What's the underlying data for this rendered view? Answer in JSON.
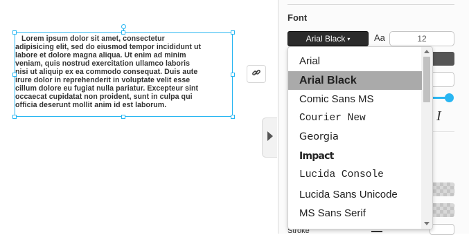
{
  "canvas": {
    "text_lines": [
      "   Lorem ipsum dolor sit amet, consectetur",
      "adipisicing elit, sed do eiusmod tempor incididunt ut",
      "labore et dolore magna aliqua. Ut enim ad minim",
      "veniam, quis nostrud exercitation ullamco laboris",
      "nisi ut aliquip ex ea commodo consequat. Duis aute",
      "irure dolor in reprehenderit in voluptate velit esse",
      "cillum dolore eu fugiat nulla pariatur. Excepteur sint",
      "occaecat cupidatat non proident, sunt in culpa qui",
      "officia deserunt mollit anim id est laborum."
    ],
    "link_icon": "link-icon",
    "selection_color": "#29b6f2"
  },
  "panel": {
    "section_title": "Font",
    "font_button_label": "Arial Black",
    "aa_label": "Aa",
    "font_size_value": "12",
    "stroke_label": "Stroke",
    "italic_label": "I",
    "collapse_icon": "chevron-right-icon"
  },
  "dropdown": {
    "options": [
      {
        "label": "Arial",
        "font": "sans",
        "selected": false
      },
      {
        "label": "Arial Black",
        "font": "sans-bold",
        "selected": true
      },
      {
        "label": "Comic Sans MS",
        "font": "sans",
        "selected": false
      },
      {
        "label": "Courier New",
        "font": "mono",
        "selected": false
      },
      {
        "label": "Georgia",
        "font": "serif",
        "selected": false
      },
      {
        "label": "Impact",
        "font": "condensed-bold",
        "selected": false
      },
      {
        "label": "Lucida Console",
        "font": "mono",
        "selected": false
      },
      {
        "label": "Lucida Sans Unicode",
        "font": "sans",
        "selected": false
      },
      {
        "label": "MS Sans Serif",
        "font": "sans",
        "selected": false
      }
    ],
    "selected_bg": "#aaaaaa"
  }
}
